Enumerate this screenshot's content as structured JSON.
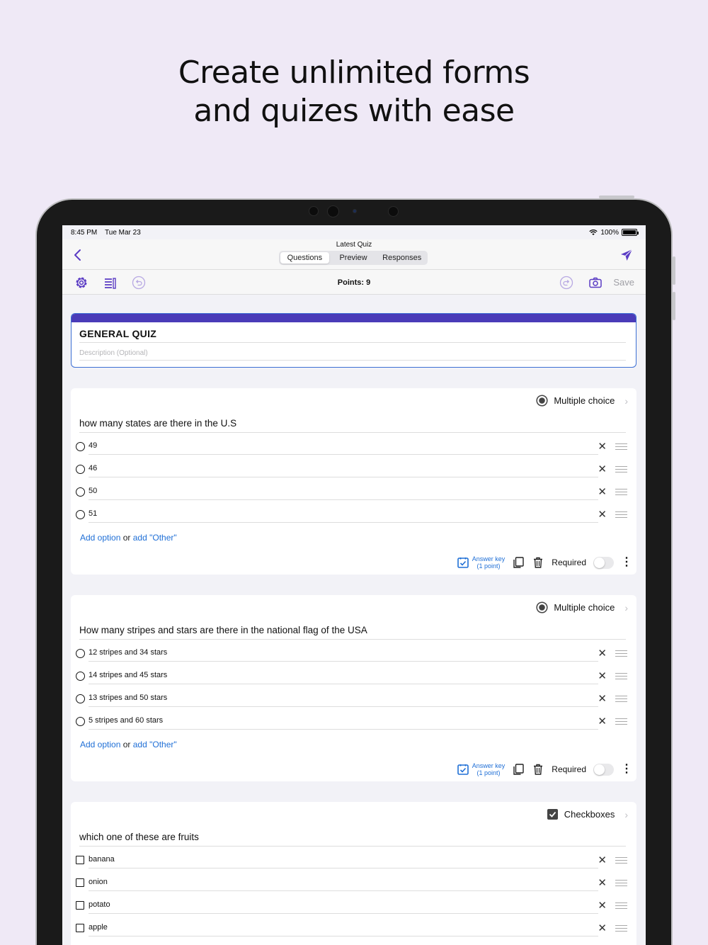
{
  "headline": {
    "line1": "Create unlimited forms",
    "line2": "and quizes with ease"
  },
  "status": {
    "time": "8:45 PM",
    "date": "Tue Mar 23",
    "battery": "100%"
  },
  "nav": {
    "title": "Latest Quiz",
    "tabs": [
      "Questions",
      "Preview",
      "Responses"
    ],
    "active_tab": "Questions"
  },
  "toolbar": {
    "points": "Points: 9",
    "save_label": "Save"
  },
  "form": {
    "title": "GENERAL QUIZ",
    "description_placeholder": "Description (Optional)"
  },
  "questions": [
    {
      "type": "Multiple choice",
      "type_icon": "radio-selected-icon",
      "text": "how many states are there in the U.S",
      "options": [
        "49",
        "46",
        "50",
        "51"
      ],
      "add_option": "Add option",
      "or": "or",
      "add_other": "add \"Other\"",
      "answer_key_line1": "Answer key",
      "answer_key_line2": "(1 point)",
      "required_label": "Required"
    },
    {
      "type": "Multiple choice",
      "type_icon": "radio-selected-icon",
      "text": "How many stripes and stars are there in the national flag of the USA",
      "options": [
        "12 stripes and 34 stars",
        "14 stripes and 45 stars",
        "13 stripes and 50 stars",
        "5 stripes and 60 stars"
      ],
      "add_option": "Add option",
      "or": "or",
      "add_other": "add \"Other\"",
      "answer_key_line1": "Answer key",
      "answer_key_line2": "(1 point)",
      "required_label": "Required"
    },
    {
      "type": "Checkboxes",
      "type_icon": "checkbox-checked-icon",
      "text": "which one of these are fruits",
      "options": [
        "banana",
        "onion",
        "potato",
        "apple"
      ]
    }
  ],
  "colors": {
    "background": "#efe9f6",
    "accent": "#5b3cc4",
    "link": "#1f6fd6",
    "header_bar": "#4a3bb8"
  }
}
